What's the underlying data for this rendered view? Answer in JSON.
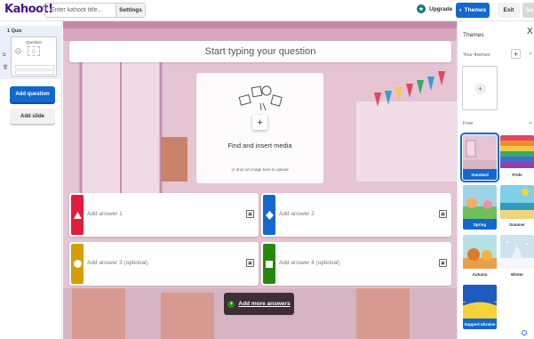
{
  "header": {
    "logo": "Kahoot!",
    "title_placeholder": "Enter kahoot title...",
    "settings_label": "Settings",
    "upgrade_label": "Upgrade",
    "themes_label": "Themes",
    "exit_label": "Exit",
    "save_label": "Sa"
  },
  "sidebar": {
    "slide_label": "1  Quiz",
    "thumb_title": "Question",
    "thumb_num": "20",
    "add_question_label": "Add question",
    "add_slide_label": "Add slide"
  },
  "editor": {
    "question_placeholder": "Start typing your question",
    "media_title": "Find and insert media",
    "media_subtitle": "or drop an image here to upload",
    "answers": [
      {
        "label": "Add answer 1",
        "color": "#e21b3c",
        "shape": "triangle"
      },
      {
        "label": "Add answer 2",
        "color": "#1368ce",
        "shape": "diamond"
      },
      {
        "label": "Add answer 3 (optional)",
        "color": "#d89e00",
        "shape": "circle"
      },
      {
        "label": "Add answer 4 (optional)",
        "color": "#26890c",
        "shape": "square"
      }
    ],
    "add_more_label": "Add more answers"
  },
  "themes_panel": {
    "title": "Themes",
    "close_label": "X",
    "your_themes_label": "Your themes",
    "free_label": "Free",
    "tiles": [
      {
        "name": "Standard",
        "label_bg": "#1368ce",
        "label_color": "#ffffff"
      },
      {
        "name": "Pride",
        "label_bg": "#ffffff",
        "label_color": "#333333"
      },
      {
        "name": "Spring",
        "label_bg": "#1368ce",
        "label_color": "#ffffff"
      },
      {
        "name": "Summer",
        "label_bg": "#ffffff",
        "label_color": "#333333"
      },
      {
        "name": "Autumn",
        "label_bg": "#ffffff",
        "label_color": "#333333"
      },
      {
        "name": "Winter",
        "label_bg": "#ffffff",
        "label_color": "#333333"
      },
      {
        "name": "Support Ukraine",
        "label_bg": "#1368ce",
        "label_color": "#ffffff"
      }
    ]
  },
  "colors": {
    "brand_purple": "#46178f",
    "primary_blue": "#1368ce",
    "red": "#e21b3c",
    "blue": "#1368ce",
    "yellow": "#d89e00",
    "green": "#26890c"
  }
}
